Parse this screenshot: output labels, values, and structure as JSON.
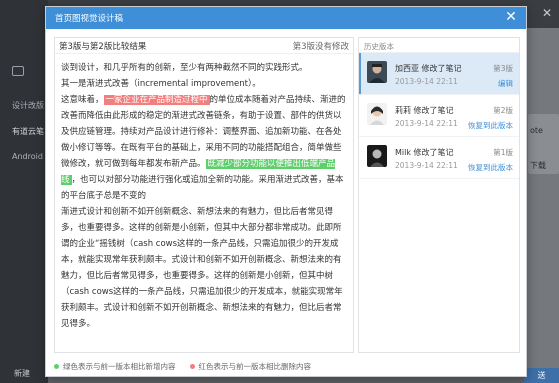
{
  "background": {
    "side_items": [
      "设计改版",
      "有道云笔",
      "Android"
    ],
    "right_texts": [
      "ote",
      "下载"
    ],
    "right_button": "送",
    "bottom_left": "新建"
  },
  "modal": {
    "title": "首页图视觉设计稿",
    "compare": {
      "left_label": "第3版与第2版比较结果",
      "right_label": "第3版没有修改",
      "paragraphs": [
        [
          {
            "t": "谈到设计，和几乎所有的创新，至少有两种截然不同的实践形式。"
          }
        ],
        [
          {
            "t": "其一是渐进式改善（incremental improvement）。"
          }
        ],
        [
          {
            "t": "这意味着，"
          },
          {
            "t": "一家企业在产品制造过程中",
            "hl": "red"
          },
          {
            "t": "的单位成本随着对产品持续、渐进的改善而降低由此形成的稳定的渐进式改善链条，有助于设置、部件的供货以及供应链管理。持续对产品设计进行修补：调整界面、追加新功能、在各处做小修订等等。在既有平台的基础上，采用不同的功能搭配组合，简单做些微修改，就可做到每年都发布新产品。"
          },
          {
            "t": "既减少部分功能以便推出低端产品线",
            "hl": "green"
          },
          {
            "t": "，也可以对部分功能进行强化或追加全新的功能。采用渐进式改善，基本的平台底子总是不变的"
          }
        ],
        [
          {
            "t": "渐进式设计和创新不如开创新概念、新想法来的有魅力，但比后者常见得多，也重要得多。这样的创新是小创新，但其中大部分都非常成功。此即所谓的企业“摇钱树（cash cows这样的一条产品线，只需追加很少的开发成本，就能实现常年获利颇丰。式设计和创新不如开创新概念、新想法来的有魅力，但比后者常见得多，也重要得多。这样的创新是小创新，但其中树（cash cows这样的一条产品线，只需追加很少的开发成本，就能实现常年获利颇丰。式设计和创新不如开创新概念、新想法来的有魅力，但比后者常见得多。"
          }
        ]
      ]
    },
    "history": {
      "header": "历史版本",
      "items": [
        {
          "author": "加西亚 修改了笔记",
          "time": "2013-9-14 22:11",
          "version": "第3版",
          "action": "编辑",
          "selected": true
        },
        {
          "author": "莉莉 修改了笔记",
          "time": "2013-9-14 22:11",
          "version": "第2版",
          "action": "恢复到此版本",
          "selected": false
        },
        {
          "author": "Milk 修改了笔记",
          "time": "2013-9-14 22:11",
          "version": "第1版",
          "action": "恢复到此版本",
          "selected": false
        }
      ]
    },
    "legend": {
      "green": {
        "label": "绿色表示与前一版本相比新增内容",
        "color": "#5fcf6c"
      },
      "red": {
        "label": "红色表示与前一版本相比删除内容",
        "color": "#f27e7e"
      }
    }
  },
  "icons": {
    "close": "close-icon",
    "chat": "chat-icon"
  }
}
